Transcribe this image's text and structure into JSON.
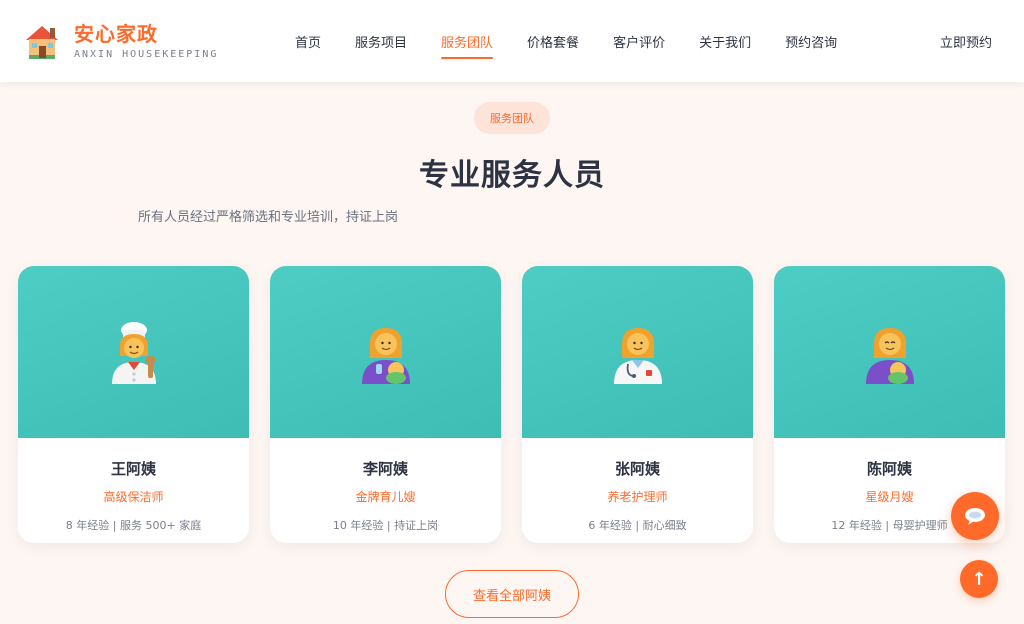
{
  "brand": {
    "title": "安心家政",
    "subtitle": "ANXIN HOUSEKEEPING",
    "accent": "#ff6a2b",
    "logo_icon": "house-icon"
  },
  "nav": {
    "items": [
      {
        "label": "首页",
        "active": false
      },
      {
        "label": "服务项目",
        "active": false
      },
      {
        "label": "服务团队",
        "active": true
      },
      {
        "label": "价格套餐",
        "active": false
      },
      {
        "label": "客户评价",
        "active": false
      },
      {
        "label": "关于我们",
        "active": false
      },
      {
        "label": "预约咨询",
        "active": false
      }
    ],
    "book_label": "立即预约"
  },
  "section": {
    "tag": "服务团队",
    "title": "专业服务人员",
    "description": "所有人员经过严格筛选和专业培训，持证上岗"
  },
  "cards": [
    {
      "name": "王阿姨",
      "role": "高级保洁师",
      "meta": "8 年经验 | 服务 500+ 家庭",
      "icon": "cook-woman-icon"
    },
    {
      "name": "李阿姨",
      "role": "金牌育儿嫂",
      "meta": "10 年经验 | 持证上岗",
      "icon": "woman-feeding-baby-icon"
    },
    {
      "name": "张阿姨",
      "role": "养老护理师",
      "meta": "6 年经验 | 耐心细致",
      "icon": "health-worker-woman-icon"
    },
    {
      "name": "陈阿姨",
      "role": "星级月嫂",
      "meta": "12 年经验 | 母婴护理师",
      "icon": "woman-feeding-baby-icon"
    }
  ],
  "more_button": "查看全部阿姨",
  "floating": {
    "chat_icon": "chat-bubble-icon",
    "top_icon": "arrow-up-icon",
    "top_glyph": "↑"
  },
  "colors": {
    "card_top": "#4ecdc4",
    "background": "#fdf6f2",
    "tag_bg": "#fde3d8"
  }
}
